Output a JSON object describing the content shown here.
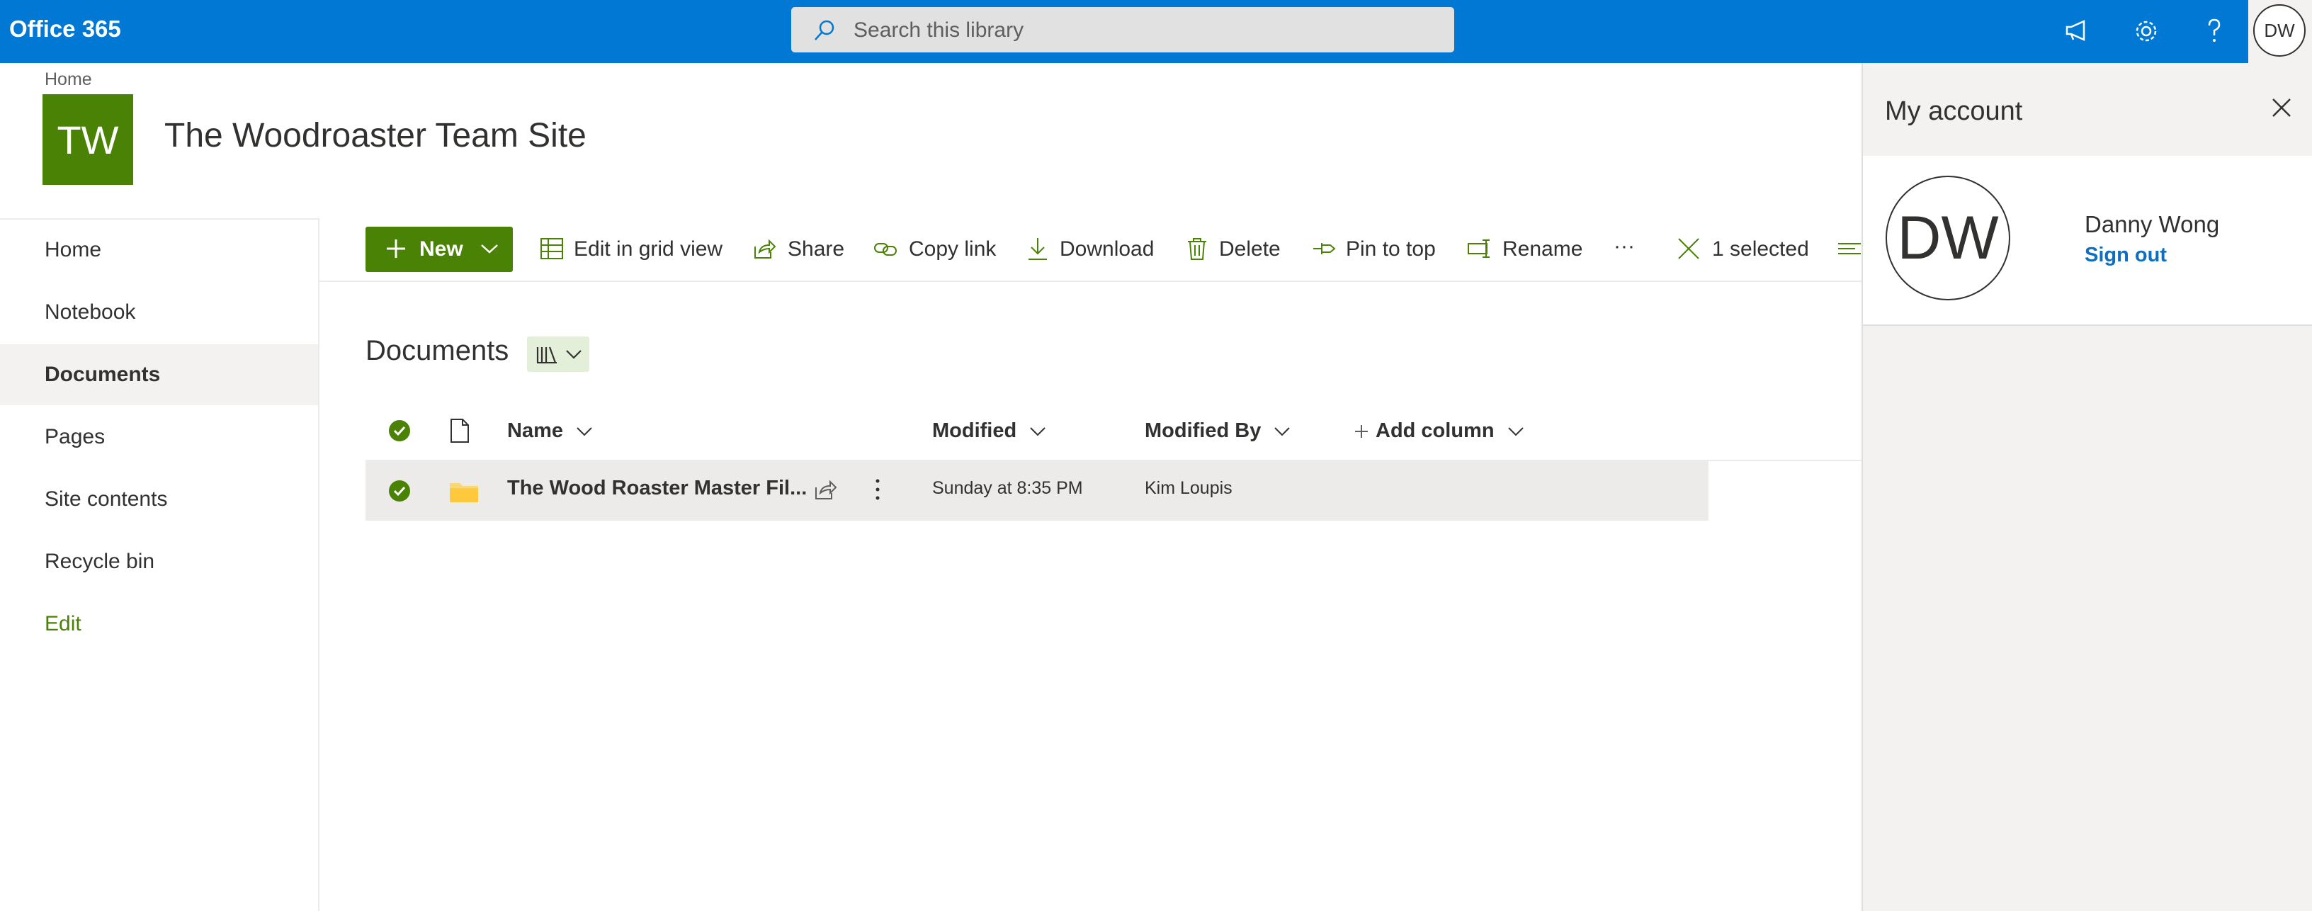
{
  "app": {
    "brand": "Office 365"
  },
  "search": {
    "placeholder": "Search this library"
  },
  "topbar": {
    "icons": [
      "megaphone-icon",
      "gear-icon",
      "help-icon"
    ],
    "avatar_initials": "DW"
  },
  "site": {
    "breadcrumb": "Home",
    "logo_initials": "TW",
    "title": "The Woodroaster Team Site"
  },
  "leftnav": {
    "items": [
      {
        "label": "Home"
      },
      {
        "label": "Notebook"
      },
      {
        "label": "Documents",
        "active": true
      },
      {
        "label": "Pages"
      },
      {
        "label": "Site contents"
      },
      {
        "label": "Recycle bin"
      },
      {
        "label": "Edit"
      }
    ]
  },
  "commandbar": {
    "new_label": "New",
    "edit_grid": "Edit in grid view",
    "share": "Share",
    "copy_link": "Copy link",
    "download": "Download",
    "delete": "Delete",
    "pin": "Pin to top",
    "rename": "Rename",
    "more": "···",
    "selected": "1 selected"
  },
  "library": {
    "title": "Documents",
    "columns": {
      "name": "Name",
      "modified": "Modified",
      "modified_by": "Modified By",
      "add_column": "Add column"
    },
    "rows": [
      {
        "name": "The Wood Roaster Master Fil...",
        "modified": "Sunday at 8:35 PM",
        "modified_by": "Kim Loupis",
        "selected": true
      }
    ]
  },
  "account_panel": {
    "title": "My account",
    "initials": "DW",
    "user_name": "Danny Wong",
    "sign_out": "Sign out"
  },
  "colors": {
    "suite_bar": "#0078d4",
    "site_accent": "#498205",
    "link_blue": "#106ebe"
  }
}
